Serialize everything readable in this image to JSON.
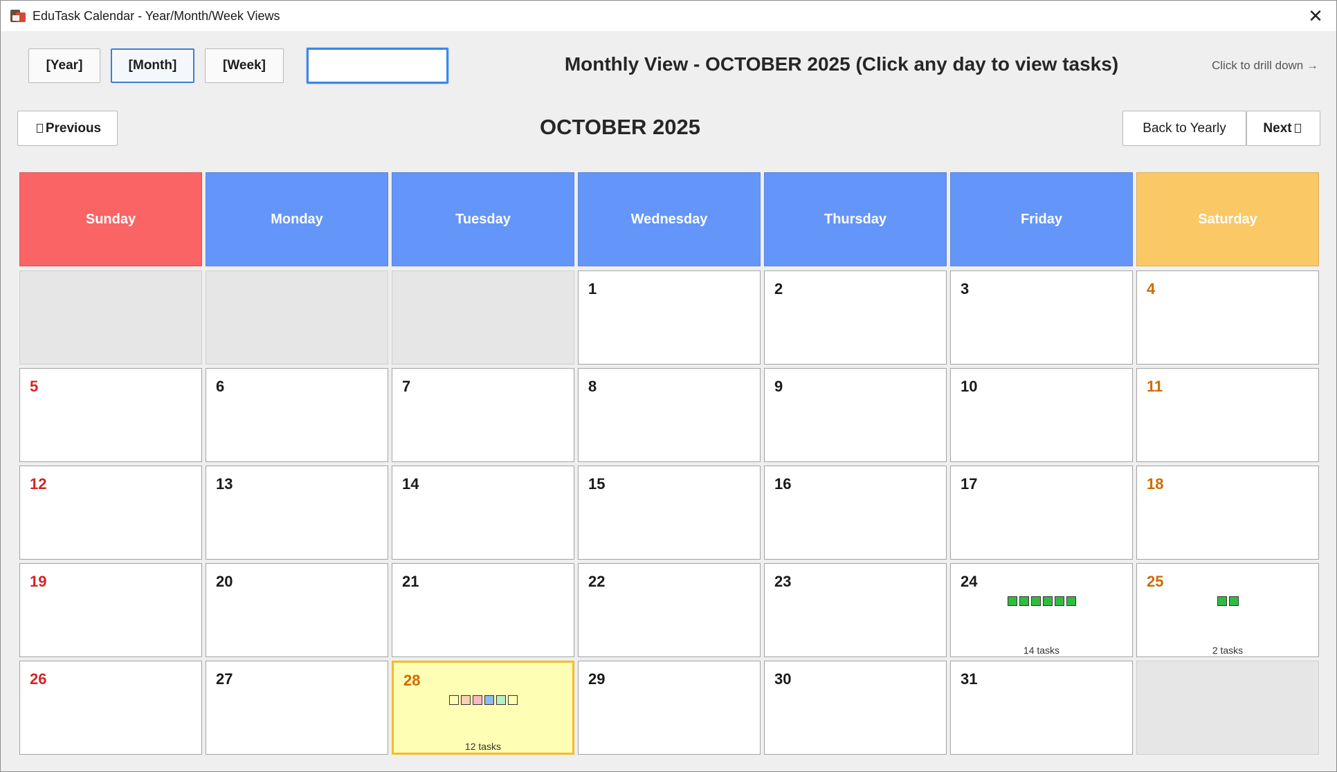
{
  "window": {
    "title": "EduTask Calendar - Year/Month/Week Views",
    "close_label": "✕"
  },
  "toolbar": {
    "year_label": "[Year]",
    "month_label": "[Month]",
    "week_label": "[Week]",
    "search_value": "",
    "view_title": "Monthly View - OCTOBER 2025 (Click any day to view tasks)",
    "drill_hint": "Click to drill down →"
  },
  "nav": {
    "previous_label": "Previous",
    "month_title": "OCTOBER 2025",
    "back_label": "Back to Yearly",
    "next_label": "Next"
  },
  "weekdays": [
    "Sunday",
    "Monday",
    "Tuesday",
    "Wednesday",
    "Thursday",
    "Friday",
    "Saturday"
  ],
  "colors": {
    "weekday_header": "#6496fa",
    "sunday_header": "#fa6464",
    "saturday_header": "#fbc866",
    "today_highlight": "#fefeb4",
    "today_border": "#f5bb2a",
    "task_green": "#2fbd3f"
  },
  "calendar": {
    "weeks": [
      [
        {
          "day": ""
        },
        {
          "day": ""
        },
        {
          "day": ""
        },
        {
          "day": "1"
        },
        {
          "day": "2"
        },
        {
          "day": "3"
        },
        {
          "day": "4"
        }
      ],
      [
        {
          "day": "5"
        },
        {
          "day": "6"
        },
        {
          "day": "7"
        },
        {
          "day": "8"
        },
        {
          "day": "9"
        },
        {
          "day": "10"
        },
        {
          "day": "11"
        }
      ],
      [
        {
          "day": "12"
        },
        {
          "day": "13"
        },
        {
          "day": "14"
        },
        {
          "day": "15"
        },
        {
          "day": "16"
        },
        {
          "day": "17"
        },
        {
          "day": "18"
        }
      ],
      [
        {
          "day": "19"
        },
        {
          "day": "20"
        },
        {
          "day": "21"
        },
        {
          "day": "22"
        },
        {
          "day": "23"
        },
        {
          "day": "24",
          "markers": [
            "#2fbd3f",
            "#2fbd3f",
            "#2fbd3f",
            "#2fbd3f",
            "#2fbd3f",
            "#2fbd3f"
          ],
          "count_text": "14 tasks"
        },
        {
          "day": "25",
          "markers": [
            "#2fbd3f",
            "#2fbd3f"
          ],
          "count_text": "2 tasks"
        }
      ],
      [
        {
          "day": "26"
        },
        {
          "day": "27"
        },
        {
          "day": "28",
          "today": true,
          "markers": [
            "#fefeb4",
            "#fcd2b4",
            "#fcb4c8",
            "#8cbcf0",
            "#b4f0c8",
            "#fefeb4"
          ],
          "count_text": "12 tasks"
        },
        {
          "day": "29"
        },
        {
          "day": "30"
        },
        {
          "day": "31"
        },
        {
          "day": ""
        }
      ]
    ]
  }
}
